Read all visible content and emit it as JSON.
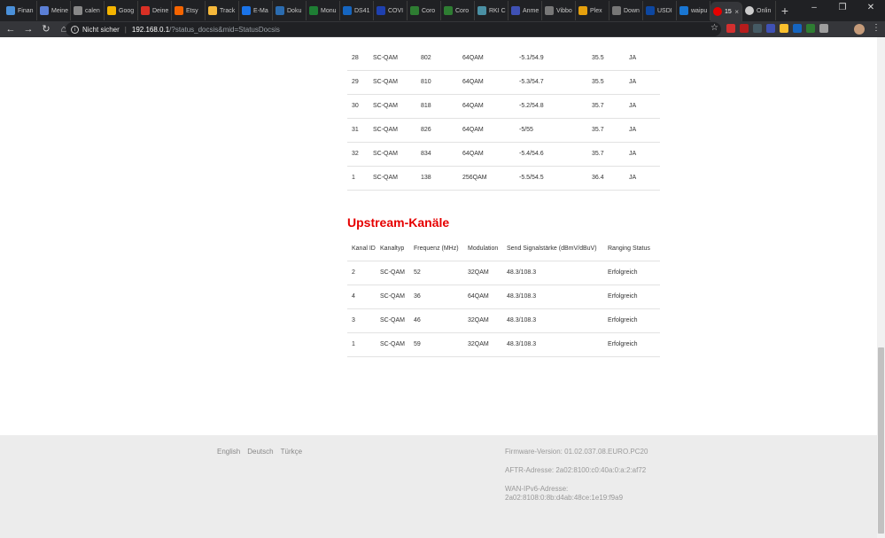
{
  "browser": {
    "tabs": [
      {
        "label": "Finan",
        "color": "#4a90d9"
      },
      {
        "label": "Meine",
        "color": "#5b7fd6"
      },
      {
        "label": "calen",
        "color": "#888888"
      },
      {
        "label": "Goog",
        "color": "#f4b400"
      },
      {
        "label": "Deine",
        "color": "#d93025"
      },
      {
        "label": "Etsy",
        "color": "#f56400"
      },
      {
        "label": "Track",
        "color": "#f6b93b"
      },
      {
        "label": "E-Ma",
        "color": "#1a73e8"
      },
      {
        "label": "Doku",
        "color": "#2b6cb0"
      },
      {
        "label": "Monu",
        "color": "#1e7e34"
      },
      {
        "label": "DS41",
        "color": "#1565c0"
      },
      {
        "label": "COVI",
        "color": "#1e40af"
      },
      {
        "label": "Coro",
        "color": "#2e7d32"
      },
      {
        "label": "Coro",
        "color": "#2e7d32"
      },
      {
        "label": "RKI C",
        "color": "#4a90a4"
      },
      {
        "label": "Anme",
        "color": "#3f51b5"
      },
      {
        "label": "Vibbo",
        "color": "#777777"
      },
      {
        "label": "Plex",
        "color": "#e5a00d"
      },
      {
        "label": "Down",
        "color": "#777777"
      },
      {
        "label": "USDI",
        "color": "#0d47a1"
      },
      {
        "label": "waipu",
        "color": "#1976d2"
      }
    ],
    "active_tab": {
      "label": "15",
      "close": "×",
      "color": "#e60000"
    },
    "last_tab": {
      "label": "Onlin",
      "color": "#cccccc"
    },
    "new_tab": "+",
    "window_controls": [
      "–",
      "❐",
      "✕"
    ],
    "nav": {
      "back": "←",
      "forward": "→",
      "reload": "↻",
      "home": "⌂"
    },
    "address": {
      "security": "Nicht sicher",
      "host": "192.168.0.1",
      "path": "/?status_docsis&mid=StatusDocsis"
    },
    "bookmark_star": "☆",
    "menu": "⋮",
    "extension_colors": [
      "#d32f2f",
      "#b71c1c",
      "#455a64",
      "#3f51b5",
      "#fbc02d",
      "#1565c0",
      "#2e7d32",
      "#9e9e9e"
    ]
  },
  "downstream": {
    "rows": [
      [
        "28",
        "SC-QAM",
        "802",
        "64QAM",
        "-5.1/54.9",
        "35.5",
        "JA"
      ],
      [
        "29",
        "SC-QAM",
        "810",
        "64QAM",
        "-5.3/54.7",
        "35.5",
        "JA"
      ],
      [
        "30",
        "SC-QAM",
        "818",
        "64QAM",
        "-5.2/54.8",
        "35.7",
        "JA"
      ],
      [
        "31",
        "SC-QAM",
        "826",
        "64QAM",
        "-5/55",
        "35.7",
        "JA"
      ],
      [
        "32",
        "SC-QAM",
        "834",
        "64QAM",
        "-5.4/54.6",
        "35.7",
        "JA"
      ],
      [
        "1",
        "SC-QAM",
        "138",
        "256QAM",
        "-5.5/54.5",
        "36.4",
        "JA"
      ]
    ]
  },
  "upstream": {
    "title": "Upstream-Kanäle",
    "headers": [
      "Kanal ID",
      "Kanaltyp",
      "Frequenz (MHz)",
      "Modulation",
      "Send Signalstärke (dBmV/dBuV)",
      "Ranging Status"
    ],
    "rows": [
      [
        "2",
        "SC-QAM",
        "52",
        "32QAM",
        "48.3/108.3",
        "Erfolgreich"
      ],
      [
        "4",
        "SC-QAM",
        "36",
        "64QAM",
        "48.3/108.3",
        "Erfolgreich"
      ],
      [
        "3",
        "SC-QAM",
        "46",
        "32QAM",
        "48.3/108.3",
        "Erfolgreich"
      ],
      [
        "1",
        "SC-QAM",
        "59",
        "32QAM",
        "48.3/108.3",
        "Erfolgreich"
      ]
    ]
  },
  "footer": {
    "languages": [
      "English",
      "Deutsch",
      "Türkçe"
    ],
    "firmware": "Firmware-Version: 01.02.037.08.EURO.PC20",
    "aftr": "AFTR-Adresse: 2a02:8100:c0:40a:0:a:2:af72",
    "wan_label": "WAN-IPv6-Adresse:",
    "wan_value": "2a02:8108:0:8b:d4ab:48ce:1e19:f9a9"
  }
}
